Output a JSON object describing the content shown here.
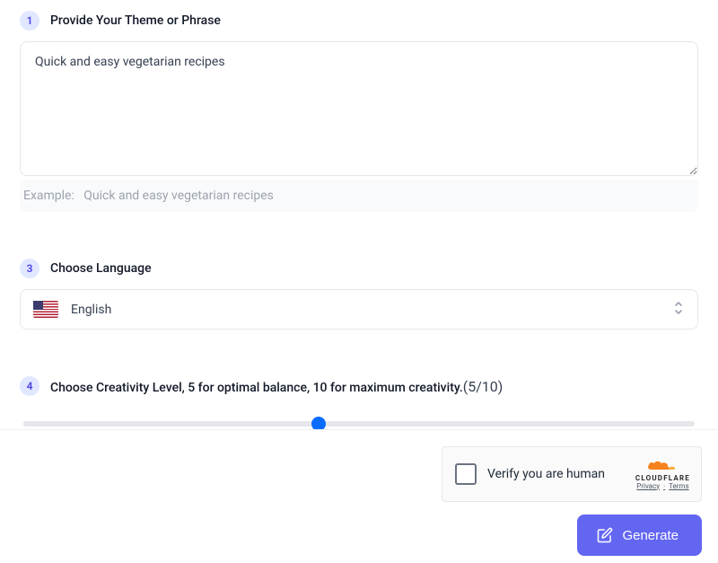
{
  "step1": {
    "number": "1",
    "title": "Provide Your Theme or Phrase",
    "value": "Quick and easy vegetarian recipes",
    "example_label": "Example:",
    "example_text": "Quick and easy vegetarian recipes"
  },
  "step3": {
    "number": "3",
    "title": "Choose Language",
    "selected": "English"
  },
  "step4": {
    "number": "4",
    "title": "Choose Creativity Level, 5 for optimal balance, 10 for maximum creativity.",
    "value_text": "(5/10)",
    "value": 5,
    "max": 10
  },
  "captcha": {
    "label": "Verify you are human",
    "brand": "CLOUDFLARE",
    "privacy": "Privacy",
    "terms": "Terms"
  },
  "actions": {
    "generate": "Generate"
  }
}
